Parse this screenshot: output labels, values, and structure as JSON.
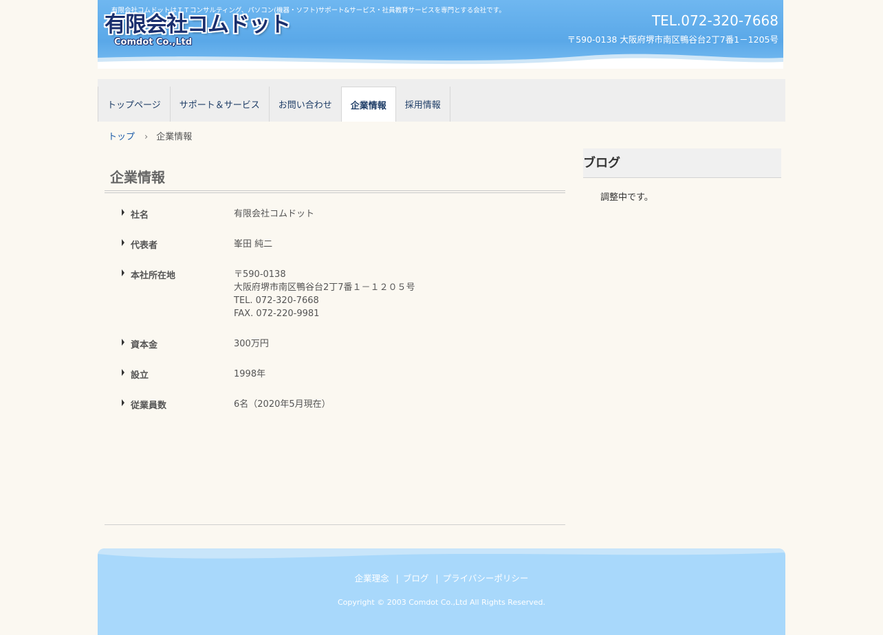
{
  "header": {
    "tagline": "有限会社コムドットはＩＴコンサルティング、パソコン(機器・ソフト)サポート&サービス・社員教育サービスを専門とする会社です。",
    "logo_jp": "有限会社コムドット",
    "logo_en": "Comdot Co.,Ltd",
    "tel": "TEL.072-320-7668",
    "address": "〒590-0138 大阪府堺市南区鴨谷台2丁7番1－1205号"
  },
  "nav": {
    "items": [
      {
        "label": "トップページ"
      },
      {
        "label": "サポート＆サービス"
      },
      {
        "label": "お問い合わせ"
      },
      {
        "label": "企業情報"
      },
      {
        "label": "採用情報"
      }
    ],
    "active": "企業情報"
  },
  "breadcrumb": {
    "home": "トップ",
    "separator": "›",
    "current": "企業情報"
  },
  "main": {
    "title": "企業情報",
    "rows": [
      {
        "label": "社名",
        "lines": [
          "有限会社コムドット"
        ]
      },
      {
        "label": "代表者",
        "lines": [
          "峯田 純二"
        ]
      },
      {
        "label": "本社所在地",
        "lines": [
          "〒590-0138",
          "大阪府堺市南区鴨谷台2丁7番１－１２０５号",
          "TEL. 072-320-7668",
          "FAX. 072-220-9981"
        ]
      },
      {
        "label": "資本金",
        "lines": [
          "300万円"
        ]
      },
      {
        "label": "設立",
        "lines": [
          "1998年"
        ]
      },
      {
        "label": "従業員数",
        "lines": [
          "6名（2020年5月現在）"
        ]
      }
    ]
  },
  "sidebar": {
    "title": "ブログ",
    "text": "調整中です。"
  },
  "footer": {
    "links": [
      {
        "label": "企業理念"
      },
      {
        "label": "ブログ"
      },
      {
        "label": "プライバシーポリシー"
      }
    ],
    "separator": "|",
    "copyright": "Copyright © 2003 Comdot Co.,Ltd All Rights Reserved."
  },
  "colors": {
    "header_blue": "#5aa8e8",
    "footer_blue": "#a8d8fb",
    "nav_text": "#1d3c66",
    "link_blue": "#1a5aa8",
    "logo_navy": "#1a2f6e"
  }
}
